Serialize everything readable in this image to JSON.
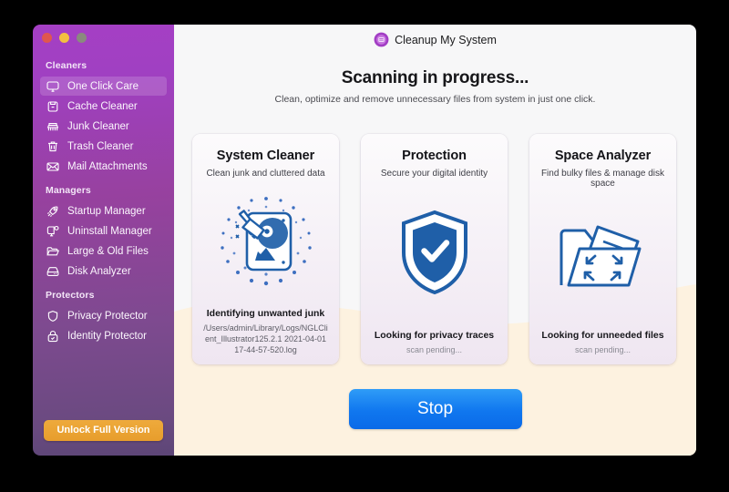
{
  "window": {
    "traffic_lights": [
      "close",
      "minimize",
      "zoom"
    ]
  },
  "brand": {
    "name": "Cleanup My System",
    "logo_icon": "app-logo-icon"
  },
  "sidebar": {
    "groups": [
      {
        "title": "Cleaners",
        "items": [
          {
            "label": "One Click Care",
            "icon": "monitor-icon",
            "active": true
          },
          {
            "label": "Cache Cleaner",
            "icon": "cache-icon",
            "active": false
          },
          {
            "label": "Junk Cleaner",
            "icon": "broom-icon",
            "active": false
          },
          {
            "label": "Trash Cleaner",
            "icon": "trash-icon",
            "active": false
          },
          {
            "label": "Mail Attachments",
            "icon": "envelope-icon",
            "active": false
          }
        ]
      },
      {
        "title": "Managers",
        "items": [
          {
            "label": "Startup Manager",
            "icon": "rocket-icon",
            "active": false
          },
          {
            "label": "Uninstall Manager",
            "icon": "app-gear-icon",
            "active": false
          },
          {
            "label": "Large & Old Files",
            "icon": "folder-icon",
            "active": false
          },
          {
            "label": "Disk Analyzer",
            "icon": "harddisk-icon",
            "active": false
          }
        ]
      },
      {
        "title": "Protectors",
        "items": [
          {
            "label": "Privacy Protector",
            "icon": "shield-icon",
            "active": false
          },
          {
            "label": "Identity Protector",
            "icon": "lock-icon",
            "active": false
          }
        ]
      }
    ],
    "unlock_label": "Unlock Full Version"
  },
  "header": {
    "title": "Scanning in progress...",
    "subtitle": "Clean, optimize and remove unnecessary files from system in just one click."
  },
  "cards": [
    {
      "title": "System Cleaner",
      "subtitle": "Clean junk and cluttered data",
      "art_icon": "broom-disk-scan-icon",
      "status": "Identifying unwanted junk",
      "detail": "/Users/admin/Library/Logs/NGLClient_Illustrator125.2.1 2021-04-01 17-44-57-520.log",
      "pending": false
    },
    {
      "title": "Protection",
      "subtitle": "Secure your digital identity",
      "art_icon": "shield-check-icon",
      "status": "Looking for privacy traces",
      "detail": "scan pending...",
      "pending": true
    },
    {
      "title": "Space Analyzer",
      "subtitle": "Find bulky files & manage disk space",
      "art_icon": "folder-expand-icon",
      "status": "Looking for unneeded files",
      "detail": "scan pending...",
      "pending": true
    }
  ],
  "actions": {
    "stop_label": "Stop"
  },
  "colors": {
    "sidebar_top": "#a53fc4",
    "sidebar_bottom": "#5d4677",
    "accent_blue": "#1077ef",
    "unlock_orange": "#e79d2c",
    "art_blue": "#1f5fa8",
    "bg_cream": "#fdf2e0",
    "bg_light": "#f7f7f8"
  }
}
